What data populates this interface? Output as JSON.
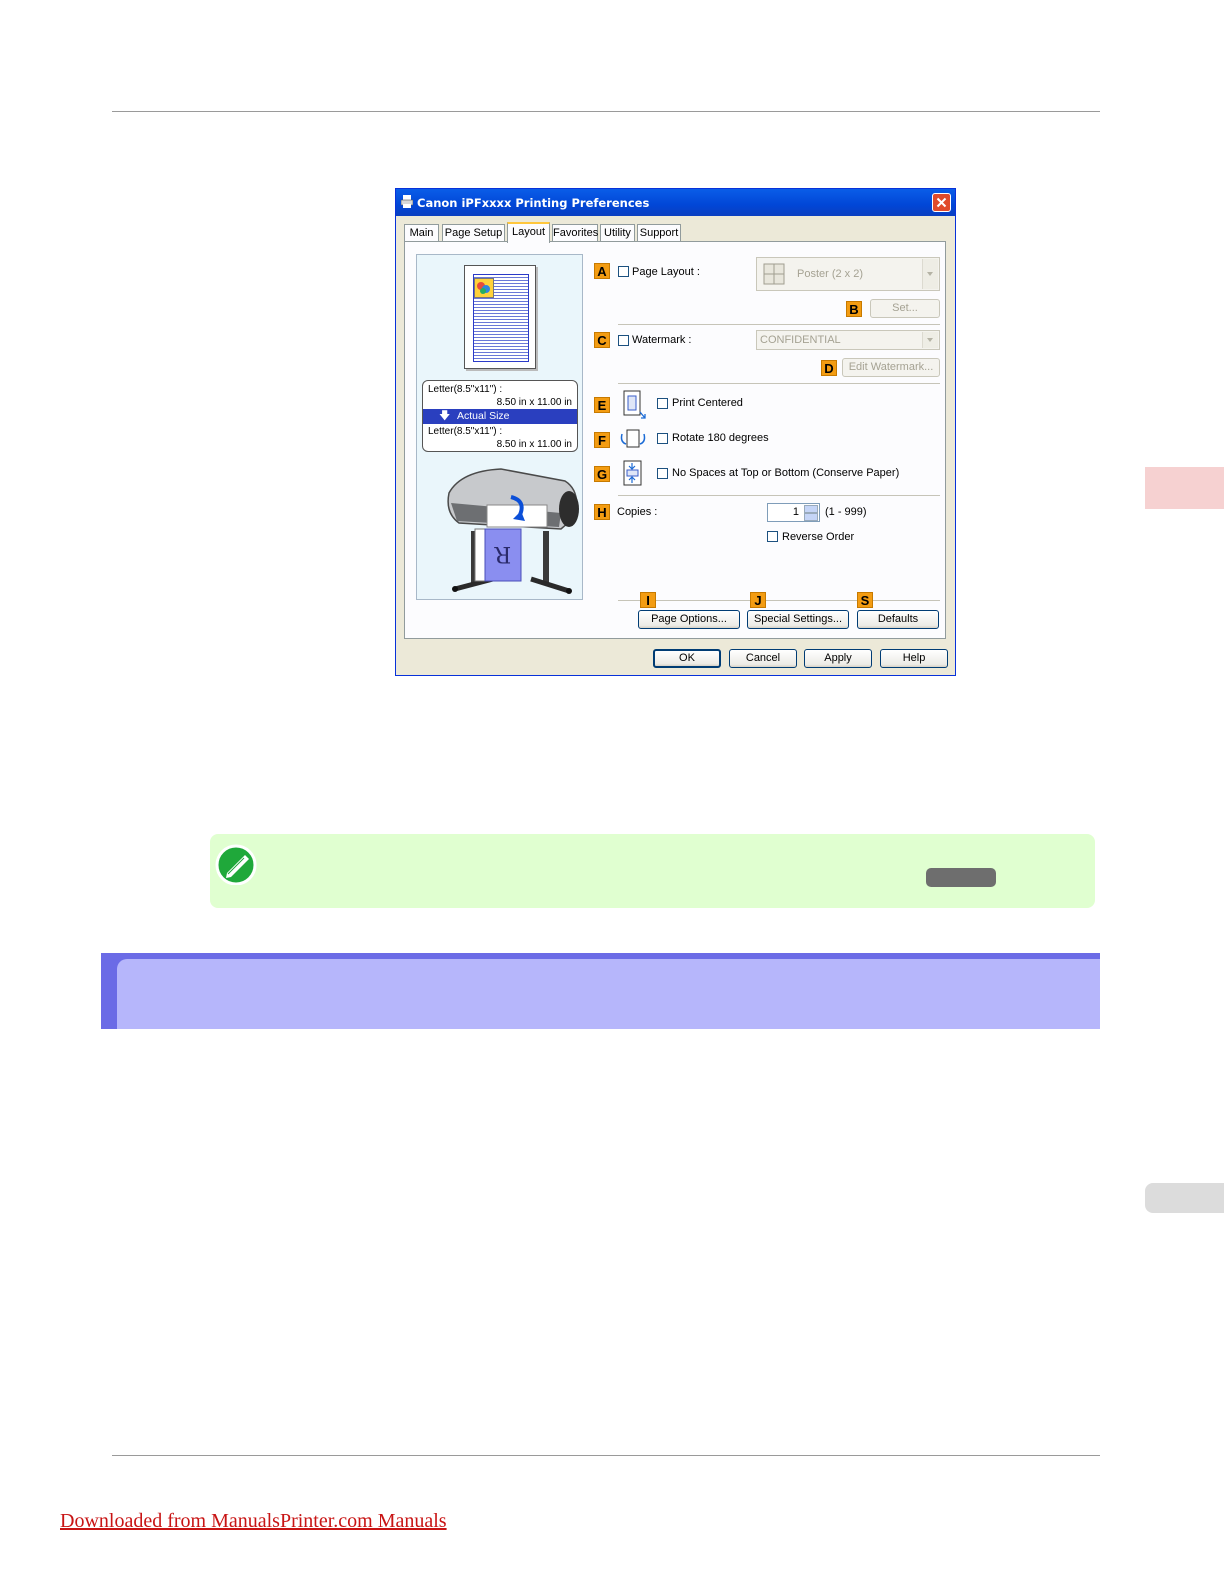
{
  "dialog": {
    "title": "Canon iPFxxxx Printing Preferences",
    "tabs": [
      "Main",
      "Page Setup",
      "Layout",
      "Favorites",
      "Utility",
      "Support"
    ],
    "active_tab": "Layout",
    "preview": {
      "orig_size": "Letter(8.5\"x11\") :",
      "orig_dims": "8.50 in x 11.00 in",
      "scale": "Actual Size",
      "out_size": "Letter(8.5\"x11\") :",
      "out_dims": "8.50 in x 11.00 in"
    },
    "tags": {
      "a": "A",
      "b": "B",
      "c": "C",
      "d": "D",
      "e": "E",
      "f": "F",
      "g": "G",
      "h": "H",
      "i": "I",
      "j": "J",
      "s": "S"
    },
    "page_layout_label": "Page Layout :",
    "page_layout_value": "Poster (2 x 2)",
    "set_button": "Set...",
    "watermark_label": "Watermark :",
    "watermark_value": "CONFIDENTIAL",
    "edit_watermark_button": "Edit Watermark...",
    "print_centered": "Print Centered",
    "rotate_180": "Rotate 180 degrees",
    "no_spaces": "No Spaces at Top or Bottom (Conserve Paper)",
    "copies_label": "Copies :",
    "copies_value": "1",
    "copies_range": "(1 - 999)",
    "reverse_order": "Reverse Order",
    "page_options_button": "Page Options...",
    "special_settings_button": "Special Settings...",
    "defaults_button": "Defaults",
    "ok_button": "OK",
    "cancel_button": "Cancel",
    "apply_button": "Apply",
    "help_button": "Help"
  },
  "footer": {
    "link": "Downloaded from ManualsPrinter.com Manuals"
  },
  "colors": {
    "note_bg": "#e0ffd0",
    "section_bar": "#6b6be6",
    "section_bg": "#b6b6fb",
    "footer_link": "#c81414",
    "tag_orange": "#f39c12"
  }
}
